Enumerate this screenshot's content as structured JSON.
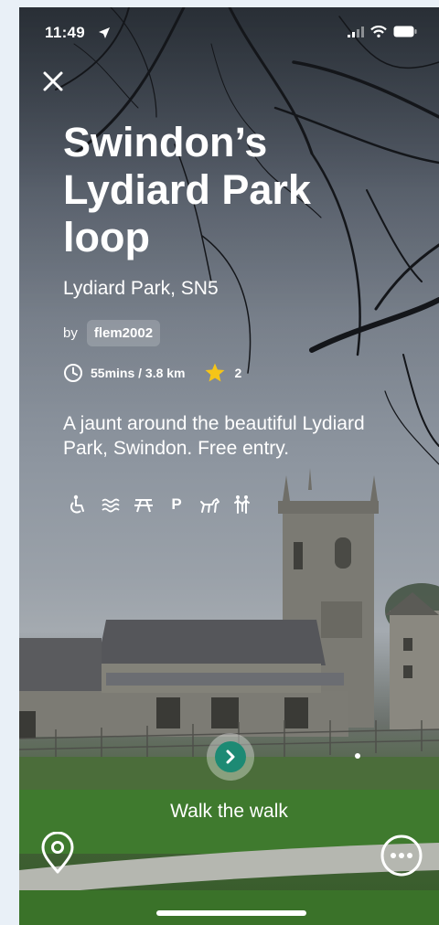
{
  "status_bar": {
    "time": "11:49"
  },
  "walk": {
    "title": "Swindon’s Lydiard Park loop",
    "location": "Lydiard Park, SN5",
    "author_prefix": "by",
    "author": "flem2002",
    "duration_distance": "55mins / 3.8 km",
    "rating": "2",
    "description": "A jaunt around the beautiful Lydiard Park, Swindon.  Free entry.",
    "amenities": [
      "accessible-icon",
      "water-icon",
      "picnic-table-icon",
      "parking-icon",
      "dog-icon",
      "family-icon"
    ],
    "parking_label": "P"
  },
  "actions": {
    "walk_label": "Walk the walk"
  },
  "colors": {
    "accent": "#1d8a74",
    "star": "#f5c518",
    "text": "#ffffff"
  }
}
